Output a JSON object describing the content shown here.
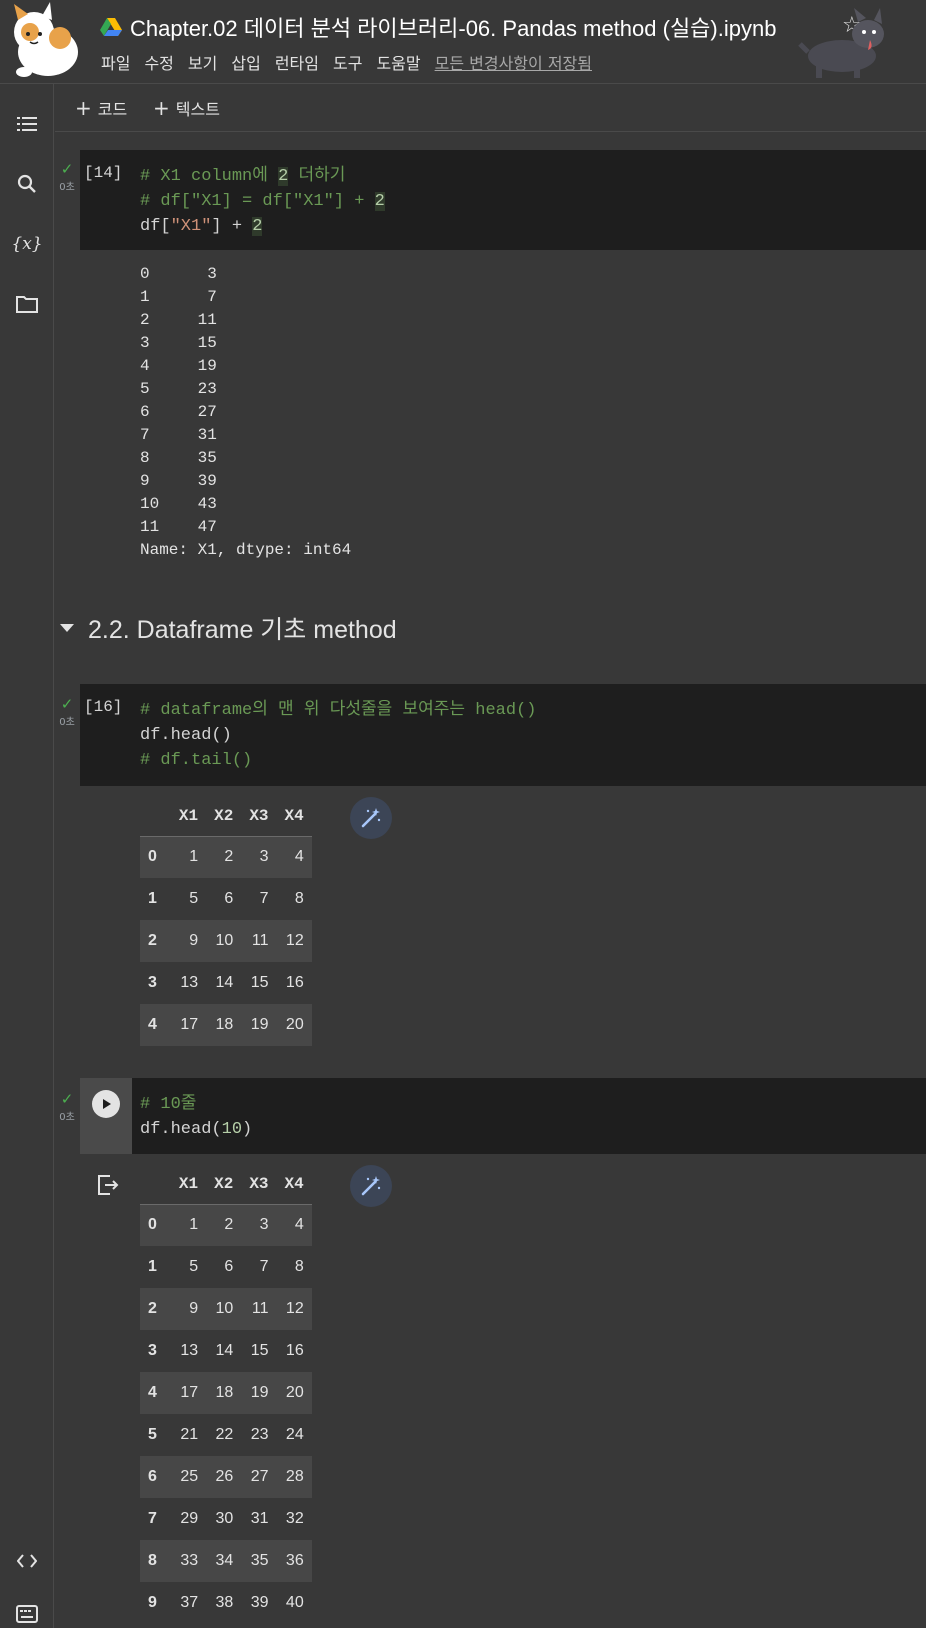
{
  "header": {
    "title": "Chapter.02 데이터 분석 라이브러리-06. Pandas method (실습).ipynb",
    "menu": [
      "파일",
      "수정",
      "보기",
      "삽입",
      "런타임",
      "도구",
      "도움말"
    ],
    "saved_status": "모든 변경사항이 저장됨"
  },
  "sidebar": {
    "icons": [
      "table-of-contents-icon",
      "search-icon",
      "variables-icon",
      "folder-icon",
      "code-snippets-icon",
      "terminal-icon"
    ],
    "variables_label": "{x}"
  },
  "toolbar": {
    "add_code": "코드",
    "add_text": "텍스트"
  },
  "cells": [
    {
      "count": "[14]",
      "time": "0초",
      "output_lines": [
        "0      3",
        "1      7",
        "2     11",
        "3     15",
        "4     19",
        "5     23",
        "6     27",
        "7     31",
        "8     35",
        "9     39",
        "10    43",
        "11    47",
        "Name: X1, dtype: int64"
      ]
    },
    {
      "count": "[16]",
      "time": "0초"
    },
    {
      "time": "0초"
    }
  ],
  "section": {
    "title": "2.2. Dataframe 기초 method"
  },
  "df_head": {
    "columns": [
      "X1",
      "X2",
      "X3",
      "X4"
    ],
    "rows": [
      {
        "index": "0",
        "values": [
          "1",
          "2",
          "3",
          "4"
        ]
      },
      {
        "index": "1",
        "values": [
          "5",
          "6",
          "7",
          "8"
        ]
      },
      {
        "index": "2",
        "values": [
          "9",
          "10",
          "11",
          "12"
        ]
      },
      {
        "index": "3",
        "values": [
          "13",
          "14",
          "15",
          "16"
        ]
      },
      {
        "index": "4",
        "values": [
          "17",
          "18",
          "19",
          "20"
        ]
      }
    ]
  },
  "df_head10": {
    "columns": [
      "X1",
      "X2",
      "X3",
      "X4"
    ],
    "rows": [
      {
        "index": "0",
        "values": [
          "1",
          "2",
          "3",
          "4"
        ]
      },
      {
        "index": "1",
        "values": [
          "5",
          "6",
          "7",
          "8"
        ]
      },
      {
        "index": "2",
        "values": [
          "9",
          "10",
          "11",
          "12"
        ]
      },
      {
        "index": "3",
        "values": [
          "13",
          "14",
          "15",
          "16"
        ]
      },
      {
        "index": "4",
        "values": [
          "17",
          "18",
          "19",
          "20"
        ]
      },
      {
        "index": "5",
        "values": [
          "21",
          "22",
          "23",
          "24"
        ]
      },
      {
        "index": "6",
        "values": [
          "25",
          "26",
          "27",
          "28"
        ]
      },
      {
        "index": "7",
        "values": [
          "29",
          "30",
          "31",
          "32"
        ]
      },
      {
        "index": "8",
        "values": [
          "33",
          "34",
          "35",
          "36"
        ]
      },
      {
        "index": "9",
        "values": [
          "37",
          "38",
          "39",
          "40"
        ]
      }
    ]
  },
  "code": {
    "c14": {
      "l1": "# X1 column에 ",
      "l1n": "2",
      "l1b": " 더하기",
      "l2": "# df[\"X1] = df[\"X1\"] + ",
      "l2n": "2",
      "l3a": "df[",
      "l3s": "\"X1\"",
      "l3b": "] + ",
      "l3n": "2"
    },
    "c16": {
      "l1": "# dataframe의 맨 위 다섯줄을 보여주는 head()",
      "l2": "df.head()",
      "l3": "# df.tail()"
    },
    "c3": {
      "l1": "# 10줄",
      "l2a": "df.head(",
      "l2n": "10",
      "l2b": ")"
    }
  },
  "colors": {
    "accent_green": "#4caf50",
    "comment": "#6a9955",
    "number": "#b5cea8",
    "string": "#ce9178",
    "code_bg": "#1e1e1e",
    "page_bg": "#383838"
  }
}
